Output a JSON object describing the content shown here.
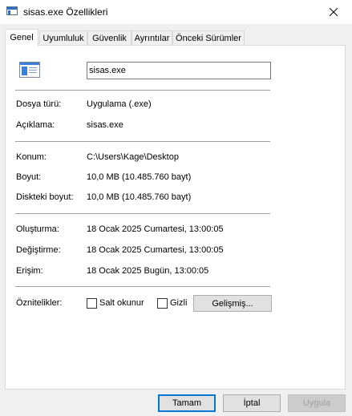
{
  "window": {
    "title": "sisas.exe Özellikleri",
    "close_glyph": "close-icon"
  },
  "tabs": [
    {
      "label": "Genel",
      "active": true
    },
    {
      "label": "Uyumluluk",
      "active": false
    },
    {
      "label": "Güvenlik",
      "active": false
    },
    {
      "label": "Ayrıntılar",
      "active": false
    },
    {
      "label": "Önceki Sürümler",
      "active": false
    }
  ],
  "general": {
    "file_name": "sisas.exe",
    "rows": {
      "type_label": "Dosya türü:",
      "type_value": "Uygulama (.exe)",
      "desc_label": "Açıklama:",
      "desc_value": "sisas.exe",
      "location_label": "Konum:",
      "location_value": "C:\\Users\\Kage\\Desktop",
      "size_label": "Boyut:",
      "size_value": "10,0 MB (10.485.760 bayt)",
      "disksize_label": "Diskteki boyut:",
      "disksize_value": "10,0 MB (10.485.760 bayt)",
      "created_label": "Oluşturma:",
      "created_value": "18 Ocak 2025 Cumartesi, 13:00:05",
      "modified_label": "Değiştirme:",
      "modified_value": "18 Ocak 2025 Cumartesi, 13:00:05",
      "accessed_label": "Erişim:",
      "accessed_value": "18 Ocak 2025 Bugün, 13:00:05"
    },
    "attributes": {
      "label": "Öznitelikler:",
      "readonly_label": "Salt okunur",
      "readonly_checked": false,
      "hidden_label": "Gizli",
      "hidden_checked": false,
      "advanced_label": "Gelişmiş..."
    }
  },
  "footer": {
    "ok_label": "Tamam",
    "cancel_label": "İptal",
    "apply_label": "Uygula"
  },
  "colors": {
    "accent": "#0078d7",
    "icon_blue": "#2f6fc4"
  }
}
